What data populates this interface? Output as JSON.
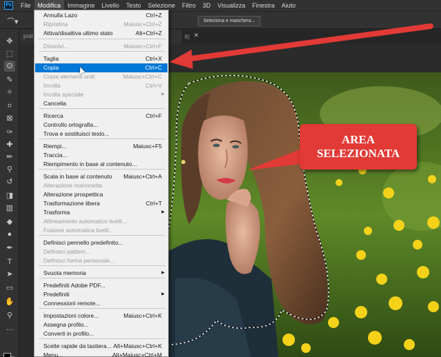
{
  "app": {
    "logo": "Ps"
  },
  "menubar": {
    "items": [
      "File",
      "Modifica",
      "Immagine",
      "Livello",
      "Testo",
      "Selezione",
      "Filtro",
      "3D",
      "Visualizza",
      "Finestra",
      "Aiuto"
    ],
    "active": "Modifica"
  },
  "options": {
    "mask_button": "Seleziona e maschera..."
  },
  "document": {
    "tab_text": "prat",
    "tab_suffix": "8)"
  },
  "menu": {
    "items": [
      {
        "label": "Annulla Lazo",
        "shortcut": "Ctrl+Z",
        "disabled": false
      },
      {
        "label": "Ripristina",
        "shortcut": "Maiusc+Ctrl+Z",
        "disabled": true
      },
      {
        "label": "Attiva/disattiva ultimo stato",
        "shortcut": "Alt+Ctrl+Z",
        "disabled": false
      },
      {
        "label": "Dissolvi...",
        "shortcut": "Maiusc+Ctrl+F",
        "disabled": true
      },
      {
        "label": "Taglia",
        "shortcut": "Ctrl+X",
        "disabled": false
      },
      {
        "label": "Copia",
        "shortcut": "Ctrl+C",
        "disabled": false,
        "highlighted": true
      },
      {
        "label": "Copia elementi uniti",
        "shortcut": "Maiusc+Ctrl+C",
        "disabled": true
      },
      {
        "label": "Incolla",
        "shortcut": "Ctrl+V",
        "disabled": true
      },
      {
        "label": "Incolla speciale",
        "shortcut": "",
        "disabled": true,
        "submenu": true
      },
      {
        "label": "Cancella",
        "shortcut": "",
        "disabled": false
      },
      {
        "label": "Ricerca",
        "shortcut": "Ctrl+F",
        "disabled": false
      },
      {
        "label": "Controllo ortografia...",
        "shortcut": "",
        "disabled": false
      },
      {
        "label": "Trova e sostituisci testo...",
        "shortcut": "",
        "disabled": false
      },
      {
        "label": "Riempi...",
        "shortcut": "Maiusc+F5",
        "disabled": false
      },
      {
        "label": "Traccia...",
        "shortcut": "",
        "disabled": false
      },
      {
        "label": "Riempimento in base al contenuto...",
        "shortcut": "",
        "disabled": false
      },
      {
        "label": "Scala in base al contenuto",
        "shortcut": "Maiusc+Ctrl+A",
        "disabled": false
      },
      {
        "label": "Alterazione marionetta",
        "shortcut": "",
        "disabled": true
      },
      {
        "label": "Alterazione prospettica",
        "shortcut": "",
        "disabled": false
      },
      {
        "label": "Trasformazione libera",
        "shortcut": "Ctrl+T",
        "disabled": false
      },
      {
        "label": "Trasforma",
        "shortcut": "",
        "disabled": false,
        "submenu": true
      },
      {
        "label": "Allineamento automatico livelli...",
        "shortcut": "",
        "disabled": true
      },
      {
        "label": "Fusione automatica livelli...",
        "shortcut": "",
        "disabled": true
      },
      {
        "label": "Definisci pennello predefinito...",
        "shortcut": "",
        "disabled": false
      },
      {
        "label": "Definisci pattern...",
        "shortcut": "",
        "disabled": true
      },
      {
        "label": "Definisci forma personale...",
        "shortcut": "",
        "disabled": true
      },
      {
        "label": "Svuota memoria",
        "shortcut": "",
        "disabled": false,
        "submenu": true
      },
      {
        "label": "Predefiniti Adobe PDF...",
        "shortcut": "",
        "disabled": false
      },
      {
        "label": "Predefiniti",
        "shortcut": "",
        "disabled": false,
        "submenu": true
      },
      {
        "label": "Connessioni remote...",
        "shortcut": "",
        "disabled": false
      },
      {
        "label": "Impostazioni colore...",
        "shortcut": "Maiusc+Ctrl+K",
        "disabled": false
      },
      {
        "label": "Assegna profilo...",
        "shortcut": "",
        "disabled": false
      },
      {
        "label": "Converti in profilo...",
        "shortcut": "",
        "disabled": false
      },
      {
        "label": "Scelte rapide da tastiera...",
        "shortcut": "Alt+Maiusc+Ctrl+K",
        "disabled": false
      },
      {
        "label": "Menu...",
        "shortcut": "Alt+Maiusc+Ctrl+M",
        "disabled": false
      }
    ]
  },
  "callout": {
    "line1": "AREA",
    "line2": "SELEZIONATA",
    "color": "#e23a36"
  },
  "colors": {
    "menu_highlight": "#0078d7",
    "ui_bg": "#323232",
    "arrow": "#e23a36"
  },
  "toolbar": {
    "tools": [
      "move-icon",
      "marquee-icon",
      "lasso-icon",
      "quick-selection-icon",
      "magic-wand-icon",
      "crop-icon",
      "frame-icon",
      "eyedropper-icon",
      "healing-brush-icon",
      "brush-icon",
      "clone-stamp-icon",
      "history-brush-icon",
      "eraser-icon",
      "gradient-icon",
      "blur-icon",
      "dodge-icon",
      "pen-icon",
      "type-icon",
      "path-selection-icon",
      "rectangle-icon",
      "hand-icon",
      "zoom-icon",
      "more-tools-icon"
    ],
    "glyphs": [
      "✥",
      "⬚",
      "ʘ",
      "✎",
      "✧",
      "⌗",
      "⊠",
      "✑",
      "✚",
      "✏",
      "⚲",
      "↺",
      "◨",
      "▥",
      "◆",
      "●",
      "✒",
      "T",
      "➤",
      "▭",
      "✋",
      "⚲",
      "…"
    ]
  }
}
